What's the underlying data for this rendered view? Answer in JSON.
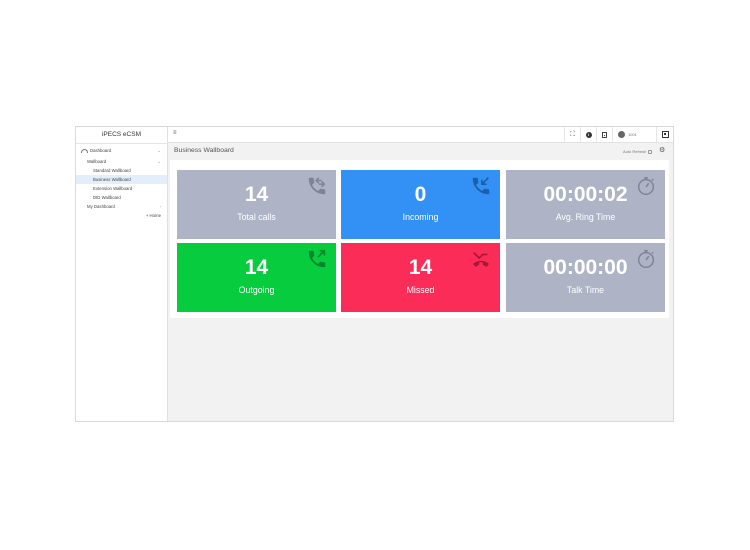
{
  "app": {
    "brand": "iPECS eCSM"
  },
  "sidebar": {
    "dashboard": "Dashboard",
    "wallboard": "Wallboard",
    "items": [
      {
        "label": "Standard Wallboard"
      },
      {
        "label": "Business Wallboard"
      },
      {
        "label": "Extension Wallboard"
      },
      {
        "label": "DID Wallboard"
      }
    ],
    "my_dashboard": "My Dashboard",
    "home": "+ Home"
  },
  "header": {
    "hamburger": "≡",
    "user_name": "1001"
  },
  "page": {
    "title": "Business Wallboard",
    "auto_refresh": "Auto Refresh"
  },
  "tiles": [
    {
      "value": "14",
      "label": "Total calls",
      "icon": "phone-transfer-icon",
      "color": "#aeb4c5"
    },
    {
      "value": "0",
      "label": "Incoming",
      "icon": "phone-incoming-icon",
      "color": "#3391f5"
    },
    {
      "value": "00:00:02",
      "label": "Avg. Ring Time",
      "icon": "stopwatch-icon",
      "color": "#aeb4c5"
    },
    {
      "value": "14",
      "label": "Outgoing",
      "icon": "phone-outgoing-icon",
      "color": "#06cc3e"
    },
    {
      "value": "14",
      "label": "Missed",
      "icon": "phone-missed-icon",
      "color": "#fb2c57"
    },
    {
      "value": "00:00:00",
      "label": "Talk Time",
      "icon": "stopwatch-icon",
      "color": "#aeb4c5"
    }
  ]
}
